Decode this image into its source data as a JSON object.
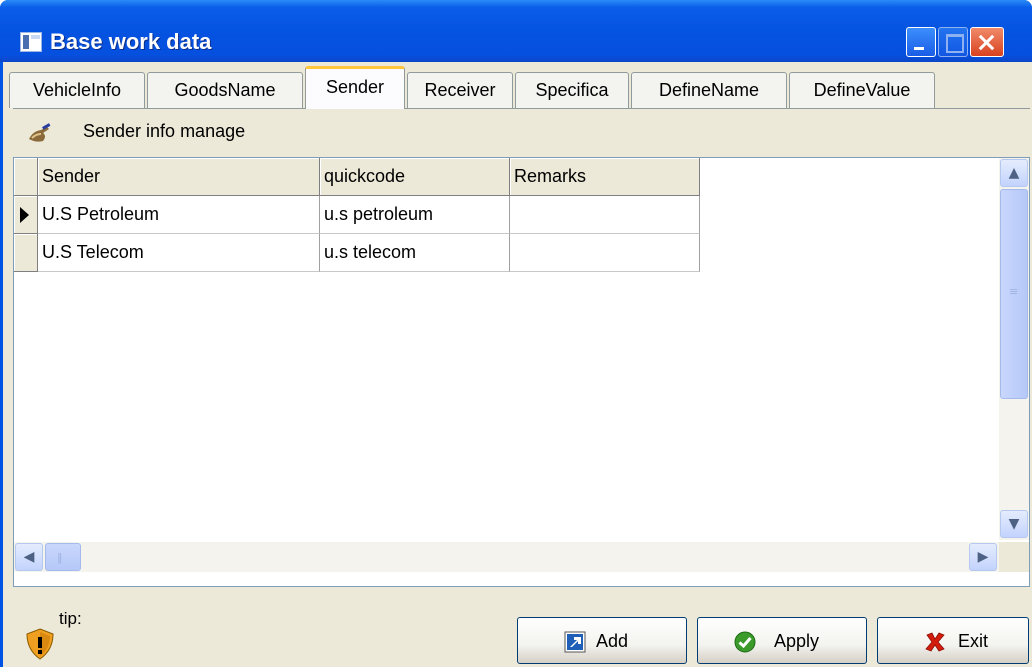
{
  "window": {
    "title": "Base work data"
  },
  "tabs": [
    {
      "label": "VehicleInfo",
      "active": false
    },
    {
      "label": "GoodsName",
      "active": false
    },
    {
      "label": "Sender",
      "active": true
    },
    {
      "label": "Receiver",
      "active": false
    },
    {
      "label": "Specifica",
      "active": false
    },
    {
      "label": "DefineName",
      "active": false
    },
    {
      "label": "DefineValue",
      "active": false
    }
  ],
  "panel": {
    "header": "Sender info manage"
  },
  "grid": {
    "columns": [
      "Sender",
      "quickcode",
      "Remarks"
    ],
    "rows": [
      {
        "sender": "U.S Petroleum",
        "quickcode": "u.s petroleum",
        "remarks": ""
      },
      {
        "sender": "U.S Telecom",
        "quickcode": "u.s telecom",
        "remarks": ""
      }
    ],
    "current_row": 0
  },
  "footer": {
    "tip": "tip:",
    "buttons": {
      "add": "Add",
      "apply": "Apply",
      "exit": "Exit"
    }
  },
  "colors": {
    "title_bar": "#0553e1",
    "face": "#ece9d8",
    "active_tab_accent": "#ffc83c"
  }
}
